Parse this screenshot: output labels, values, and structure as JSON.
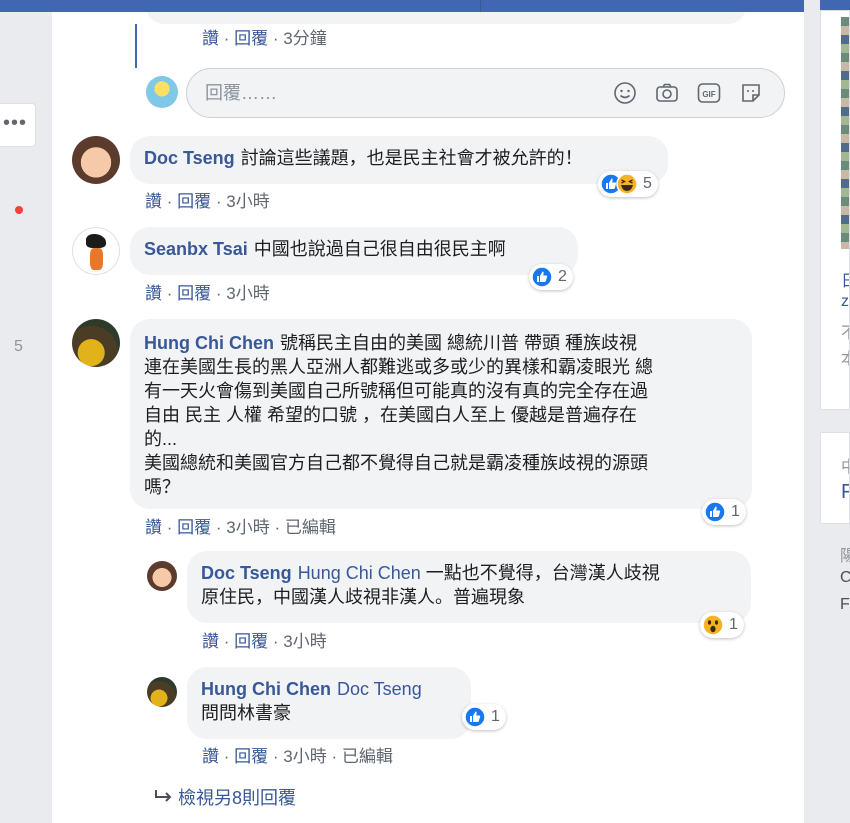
{
  "right_panel": {
    "t1": "日",
    "t2": "z",
    "t3": "不",
    "t4": "本",
    "t5": "中",
    "t6": "F",
    "t7": "陽",
    "t8": "C",
    "t9": "F"
  },
  "left_panel": {
    "more_label": "•••",
    "badge_count": "5"
  },
  "top_comment_meta": {
    "like": "讚",
    "reply": "回覆",
    "time": "3分鐘",
    "sep": "·"
  },
  "reply_composer": {
    "placeholder": "回覆……"
  },
  "comments": [
    {
      "author": "Doc Tseng",
      "text": "討論這些議題，也是民主社會才被允許的！",
      "reactions": {
        "icons": [
          "like-icon",
          "haha-icon"
        ],
        "count": "5"
      },
      "meta": {
        "like": "讚",
        "reply": "回覆",
        "time": "3小時"
      }
    },
    {
      "author": "Seanbx Tsai",
      "text": "中國也說過自己很自由很民主啊",
      "reactions": {
        "icons": [
          "like-icon"
        ],
        "count": "2"
      },
      "meta": {
        "like": "讚",
        "reply": "回覆",
        "time": "3小時"
      }
    },
    {
      "author": "Hung Chi Chen",
      "text_line1": "號稱民主自由的美國 總統川普 帶頭 種族歧視",
      "text_line2": "連在美國生長的黑人亞洲人都難逃或多或少的異樣和霸凌眼光 總",
      "text_line3": "有一天火會傷到美國自己所號稱但可能真的沒有真的完全存在過",
      "text_line4": "自由 民主 人權 希望的口號 ，在美國白人至上 優越是普遍存在",
      "text_line5": "的...",
      "text_line6": "美國總統和美國官方自己都不覺得自己就是霸凌種族歧視的源頭",
      "text_line7": "嗎？",
      "reactions": {
        "icons": [
          "like-icon"
        ],
        "count": "1"
      },
      "meta": {
        "like": "讚",
        "reply": "回覆",
        "time": "3小時",
        "edited": "已編輯"
      }
    }
  ],
  "replies": [
    {
      "author": "Doc Tseng",
      "mention": "Hung Chi Chen",
      "text_line1": "一點也不覺得，台灣漢人歧視",
      "text_line2": "原住民，中國漢人歧視非漢人。普遍現象",
      "reactions": {
        "icons": [
          "wow-icon"
        ],
        "count": "1"
      },
      "meta": {
        "like": "讚",
        "reply": "回覆",
        "time": "3小時"
      }
    },
    {
      "author": "Hung Chi Chen",
      "mention": "Doc Tseng",
      "text": "問問林書豪",
      "reactions": {
        "icons": [
          "like-icon"
        ],
        "count": "1"
      },
      "meta": {
        "like": "讚",
        "reply": "回覆",
        "time": "3小時",
        "edited": "已編輯"
      }
    }
  ],
  "view_more_replies": "檢視另8則回覆",
  "colors": {
    "link": "#385898",
    "bubble": "#f2f3f5",
    "brand": "#4267b2",
    "meta": "#606770"
  }
}
